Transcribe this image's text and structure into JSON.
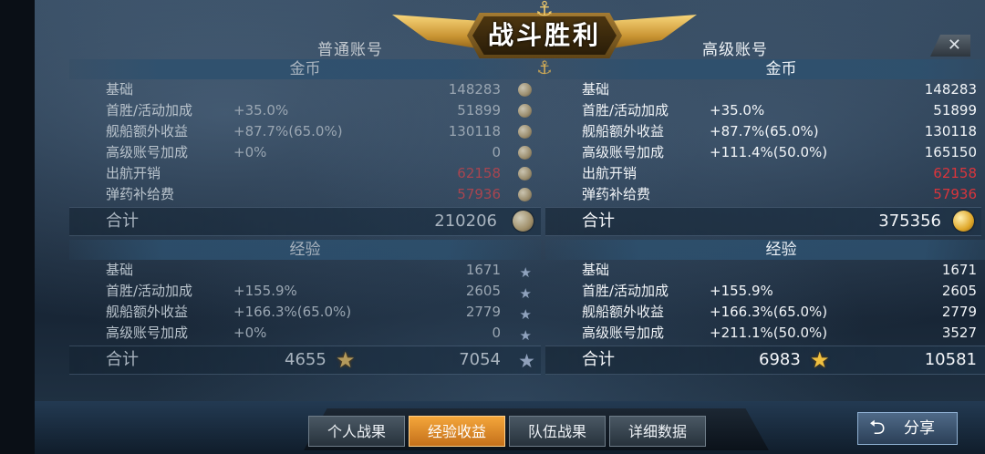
{
  "header": {
    "title": "战斗胜利",
    "close": "✕"
  },
  "left": {
    "account_title": "普通账号",
    "gold": {
      "heading": "金币",
      "rows": [
        {
          "label": "基础",
          "mod": "",
          "value": "148283"
        },
        {
          "label": "首胜/活动加成",
          "mod": "+35.0%",
          "value": "51899"
        },
        {
          "label": "舰船额外收益",
          "mod": "+87.7%(65.0%)",
          "value": "130118"
        },
        {
          "label": "高级账号加成",
          "mod": "+0%",
          "value": "0"
        },
        {
          "label": "出航开销",
          "mod": "",
          "value": "62158",
          "negative": true
        },
        {
          "label": "弹药补给费",
          "mod": "",
          "value": "57936",
          "negative": true
        }
      ],
      "total_label": "合计",
      "total_value": "210206"
    },
    "exp": {
      "heading": "经验",
      "rows": [
        {
          "label": "基础",
          "mod": "",
          "value": "1671"
        },
        {
          "label": "首胜/活动加成",
          "mod": "+155.9%",
          "value": "2605"
        },
        {
          "label": "舰船额外收益",
          "mod": "+166.3%(65.0%)",
          "value": "2779"
        },
        {
          "label": "高级账号加成",
          "mod": "+0%",
          "value": "0"
        }
      ],
      "total_label": "合计",
      "total_elite": "4655",
      "total_value": "7054"
    }
  },
  "right": {
    "account_title": "高级账号",
    "gold": {
      "heading": "金币",
      "rows": [
        {
          "label": "基础",
          "mod": "",
          "value": "148283"
        },
        {
          "label": "首胜/活动加成",
          "mod": "+35.0%",
          "value": "51899"
        },
        {
          "label": "舰船额外收益",
          "mod": "+87.7%(65.0%)",
          "value": "130118"
        },
        {
          "label": "高级账号加成",
          "mod": "+111.4%(50.0%)",
          "value": "165150"
        },
        {
          "label": "出航开销",
          "mod": "",
          "value": "62158",
          "negative": true
        },
        {
          "label": "弹药补给费",
          "mod": "",
          "value": "57936",
          "negative": true
        }
      ],
      "total_label": "合计",
      "total_value": "375356"
    },
    "exp": {
      "heading": "经验",
      "rows": [
        {
          "label": "基础",
          "mod": "",
          "value": "1671"
        },
        {
          "label": "首胜/活动加成",
          "mod": "+155.9%",
          "value": "2605"
        },
        {
          "label": "舰船额外收益",
          "mod": "+166.3%(65.0%)",
          "value": "2779"
        },
        {
          "label": "高级账号加成",
          "mod": "+211.1%(50.0%)",
          "value": "3527"
        }
      ],
      "total_label": "合计",
      "total_elite": "6983",
      "total_value": "10581"
    }
  },
  "tabs": [
    {
      "label": "个人战果",
      "active": false
    },
    {
      "label": "经验收益",
      "active": true
    },
    {
      "label": "队伍战果",
      "active": false
    },
    {
      "label": "详细数据",
      "active": false
    }
  ],
  "share": {
    "label": "分享",
    "icon": "return-arrow-icon"
  },
  "colors": {
    "negative": "#d9353c",
    "active_tab": "#f4a63b",
    "gold": "#e0a82a"
  }
}
